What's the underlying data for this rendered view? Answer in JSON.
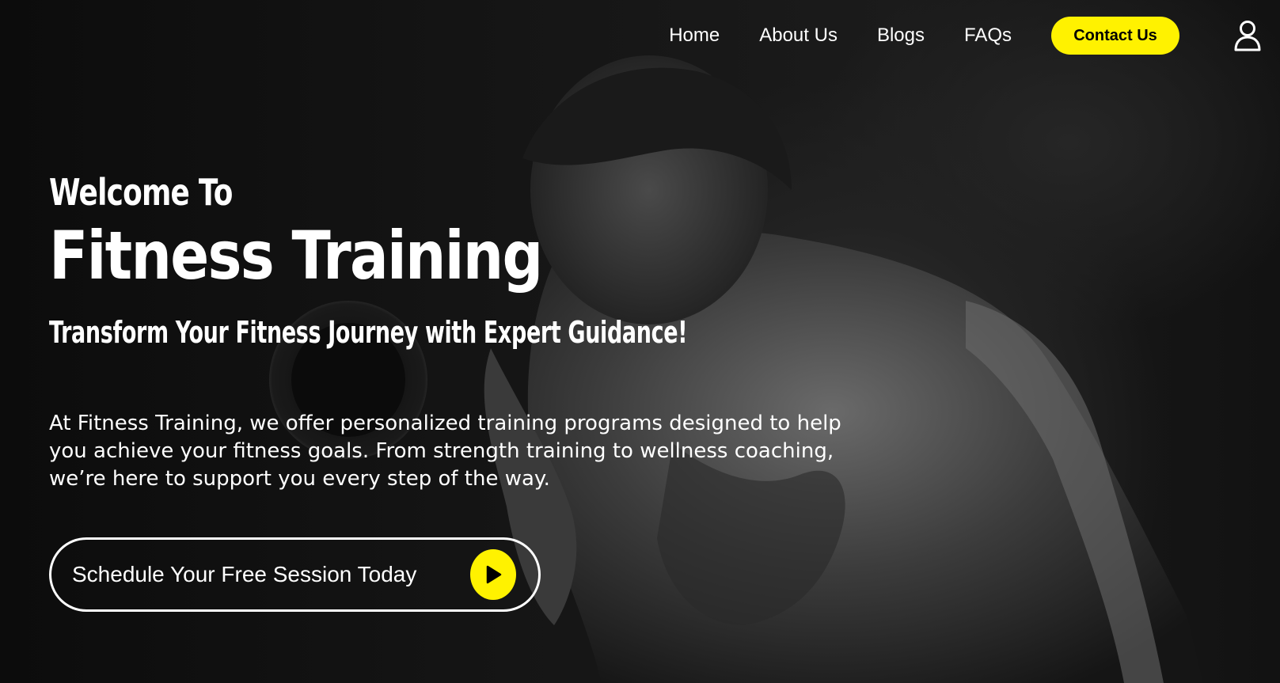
{
  "colors": {
    "accent": "#fff200",
    "text": "#ffffff",
    "background": "#0e0e0e"
  },
  "nav": {
    "items": [
      "Home",
      "About Us",
      "Blogs",
      "FAQs"
    ],
    "contact_label": "Contact Us",
    "user_icon": "user-icon"
  },
  "hero": {
    "welcome": "Welcome To",
    "title": "Fitness Training",
    "subtitle": "Transform Your Fitness Journey with Expert Guidance!",
    "description": "At Fitness Training, we offer personalized training programs designed to help you achieve your fitness goals. From strength training to wellness coaching, we’re here to support you every step of the way.",
    "cta_label": "Schedule Your Free Session Today",
    "cta_icon": "play-icon",
    "background_image": "athlete-with-dumbbell"
  }
}
